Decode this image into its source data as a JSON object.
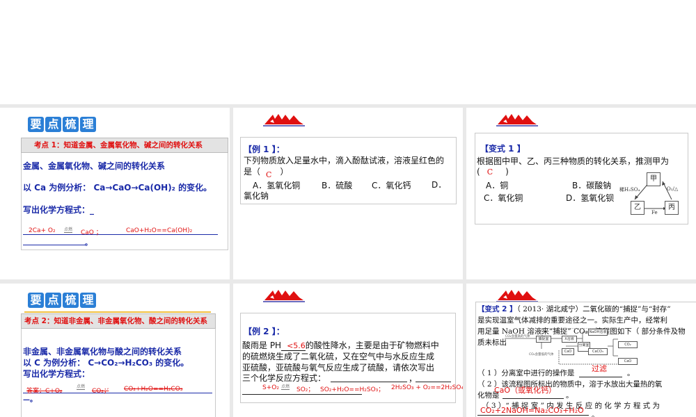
{
  "slides": [
    {
      "badge": [
        "要",
        "点",
        "梳",
        "理"
      ],
      "header": "考点 1：知道金属、金属氧化物、碱之间的转化关系",
      "line1": "金属、金属氧化物、碱之间的转化关系",
      "line2": "以 Ca 为例分析： Ca→CaO→Ca(OH)₂ 的变化。",
      "line3": "写出化学方程式：_",
      "answer1": "2Ca+ O₂",
      "condition": "点燃",
      "answer2": "CaO ；",
      "answer3": "CaO+H₂O==Ca(OH)₂",
      "end": "。"
    },
    {
      "title": "【例 1 】：",
      "question": "下列物质放入足量水中，滴入酚酞试液，溶液呈红色的是（",
      "answer": "C",
      "close": "）",
      "options": [
        "A．氢氧化铜",
        "B．硫酸",
        "C．氧化钙",
        "D．氯化钠"
      ]
    },
    {
      "title": "【变式 1 】",
      "question": "根据图中甲、乙、丙三种物质的转化关系，推测甲为",
      "paren_open": "(",
      "answer": "C",
      "paren_close": ")",
      "options": [
        "A．铜",
        "B．碳酸钠",
        "C．氧化铜",
        "D．氢氧化钡"
      ],
      "diagram": {
        "top": "甲",
        "left": "乙",
        "right": "丙",
        "label_left": "稀H₂SO₄",
        "label_right": "O₂/△",
        "label_bottom": "Fe"
      }
    },
    {
      "badge": [
        "要",
        "点",
        "梳",
        "理"
      ],
      "header": "考点 2：知道非金属、非金属氧化物、酸之间的转化关系",
      "line1": "非金属、非金属氧化物与酸之间的转化关系",
      "line2": "以 C 为例分析： C→CO₂→H₂CO₃ 的变化。",
      "line3": "写出化学方程式：",
      "answer1": "答案：C+O₂",
      "condition": "点燃",
      "answer2": "CO₂；’",
      "answer3": "CO₂+H₂O==H₂CO₃",
      "end": "—。"
    },
    {
      "title": "【例 2 】：",
      "q_pre": "酸雨是 PH",
      "q_ans": "<5.6",
      "q_post": "的酸性降水，主要是由于矿物燃料中",
      "line2": "的硫燃烧生成了二氧化硫，又在空气中与水反应生成",
      "line3": "亚硫酸，亚硫酸与氧气反应生成了硫酸，请依次写出",
      "line4": "三个化学反应方程式：",
      "comma": "，",
      "eq1": "S+O₂",
      "condition": "点燃",
      "eq1b": "SO₂；",
      "eq2": "SO₂+H₂O==H₂SO₃；",
      "eq3": "2H₂SO₃ + O₂==2H₂SO₄"
    },
    {
      "title": "【变式 2 】",
      "line1": "（ 2013· 湖北咸宁）二氧化碳的“捕捉”与“封存”",
      "line2": "是实现温室气体减排的重要途径之一。实际生产中，经常利",
      "line3": "用足量 NaOH 溶液来“捕捉” CO₂，流程图如下（ 部分条件及物",
      "line4": "质未标出",
      "flow": {
        "in": "CO₂含量高的气体",
        "out": "CO₂含量低的气体",
        "capture": "捕捉室",
        "x": "X溶液",
        "sep": "分离室",
        "naoh": "NaOH溶液",
        "cao1": "CaO",
        "caco3": "CaCO₃",
        "co2": "CO₂",
        "cao2": "CaO"
      },
      "q1": "（ 1 ）分离室中进行的操作是",
      "a1": "过滤",
      "q1_end": "。",
      "q2": "（ 2 ）该流程图所标出的物质中，溶于水放出大量热的氧",
      "q2b": "化物是",
      "a2": "CaO（或氧化钙）",
      "q2_end": "。",
      "q3": "（ 3 ）“ 捕 捉 室 ” 内 发 生 反 应 的 化 学 方 程 式 为",
      "a3": "CO₂+2NaOH=Na₂CO₃+H₂O",
      "q3_end": "。"
    }
  ],
  "colors": {
    "badge": "#2b7fd6",
    "answer": "#e01010",
    "heading": "#1a2aa8",
    "separator": "#e9e9e9"
  }
}
